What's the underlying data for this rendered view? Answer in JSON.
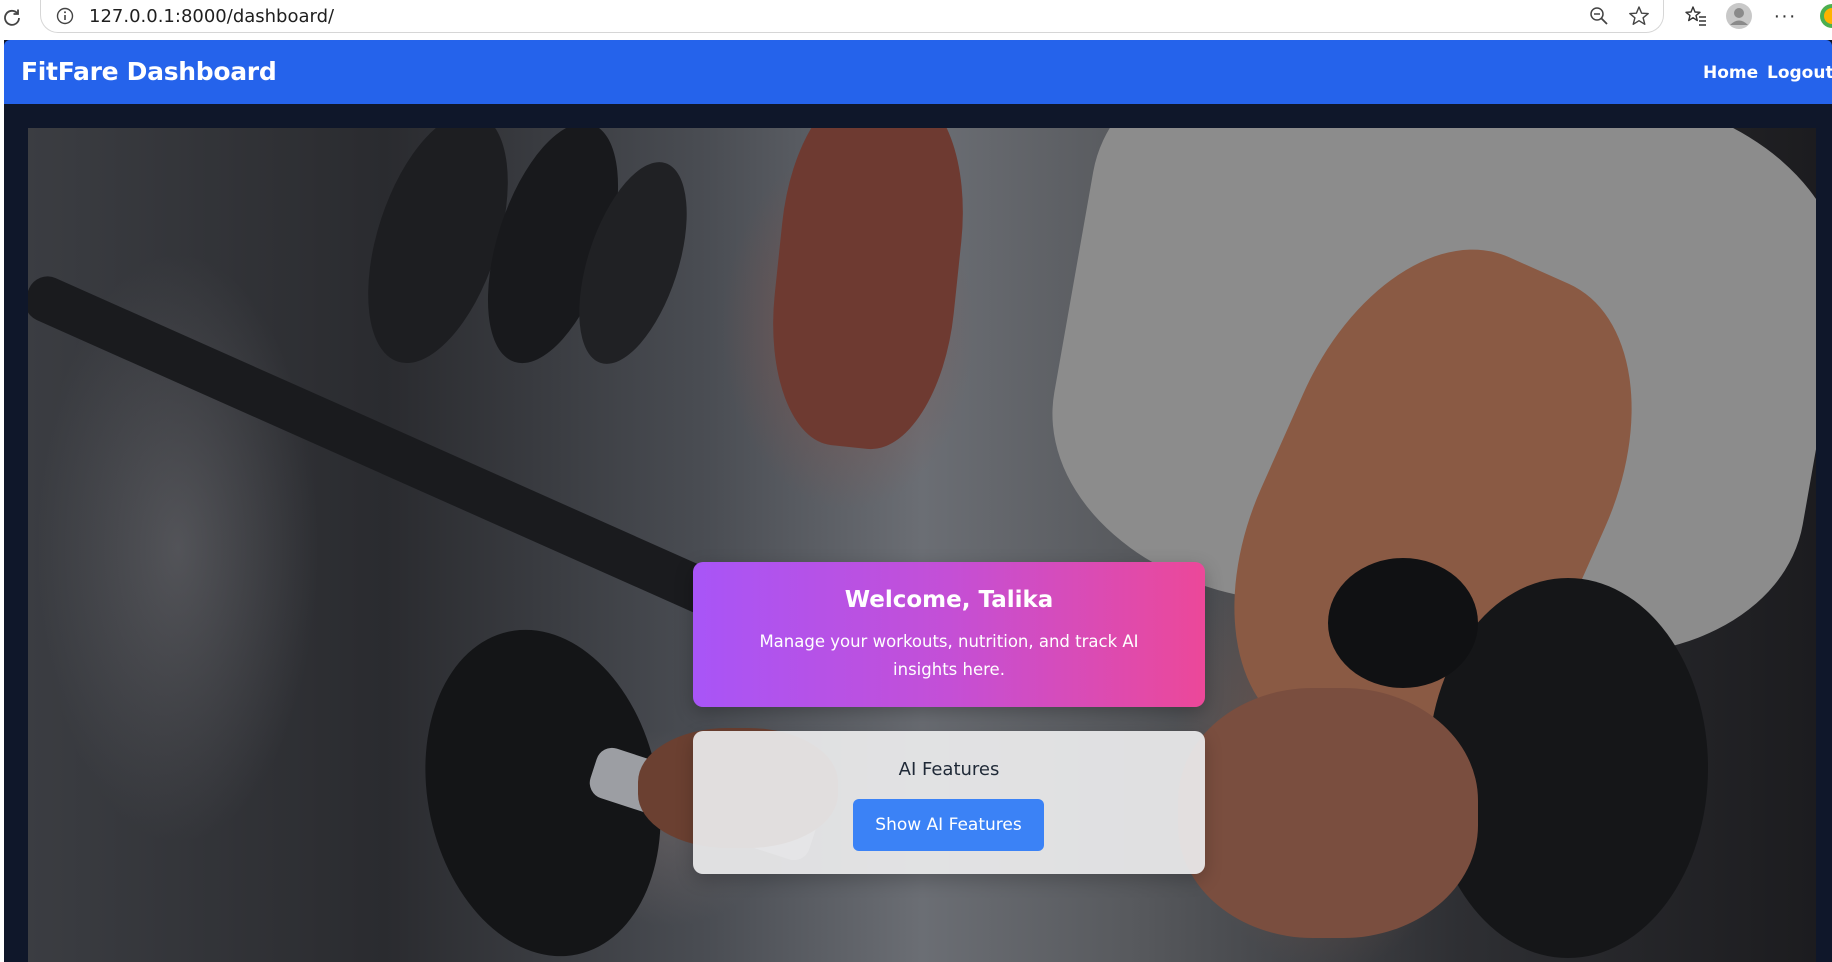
{
  "browser": {
    "url": "127.0.0.1:8000/dashboard/",
    "icons": [
      "reload-icon",
      "info-icon",
      "zoom-out-icon",
      "star-icon",
      "favorites-icon",
      "profile-avatar",
      "more-icon",
      "copilot-icon"
    ],
    "more_label": "···"
  },
  "navbar": {
    "brand": "FitFare Dashboard",
    "links": [
      {
        "label": "Home"
      },
      {
        "label": "Logout"
      }
    ],
    "color": "#2563eb"
  },
  "welcome": {
    "title": "Welcome, Talika",
    "subtitle": "Manage your workouts, nutrition, and track AI insights here.",
    "gradient": [
      "#a855f7",
      "#ec4899"
    ]
  },
  "ai_features": {
    "title": "AI Features",
    "button_label": "Show AI Features",
    "button_color": "#3b82f6"
  },
  "colors": {
    "page_background": "#0f172a"
  }
}
